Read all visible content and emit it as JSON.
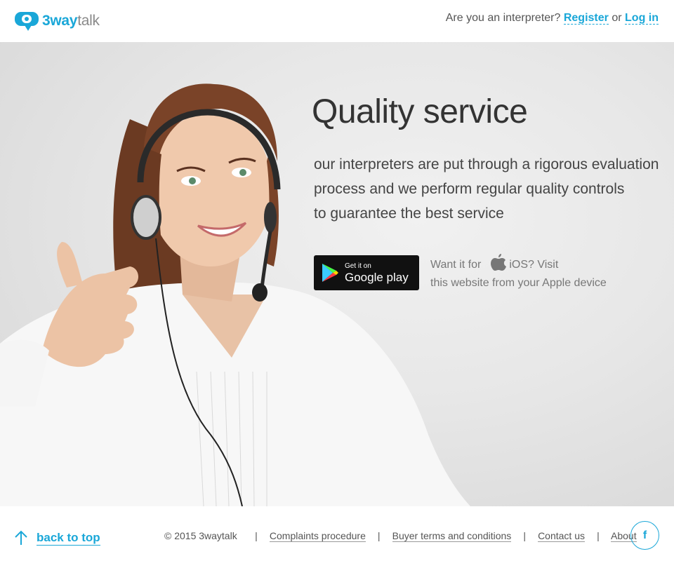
{
  "header": {
    "logo": {
      "bold": "3way",
      "light": "talk"
    },
    "prompt": "Are you an interpreter?",
    "register": "Register",
    "or": "or",
    "login": "Log in"
  },
  "hero": {
    "title": "Quality service",
    "lead": [
      "our interpreters are put through a rigorous evaluation",
      "process and we perform regular quality controls",
      "to guarantee the best service"
    ],
    "google_play": {
      "small": "Get it on",
      "big": "Google play"
    },
    "ios_note": {
      "prefix": "Want it for",
      "suffix": "iOS? Visit",
      "line2": "this website from your Apple device"
    }
  },
  "footer": {
    "back_to_top": "back to top",
    "copyright": "© 2015 3waytalk",
    "links": [
      "Complaints procedure",
      "Buyer terms and conditions",
      "Contact us",
      "About"
    ],
    "social": "f"
  },
  "colors": {
    "accent": "#1aa7d8",
    "text": "#333333",
    "hero_bg": "#e7e7e7"
  }
}
